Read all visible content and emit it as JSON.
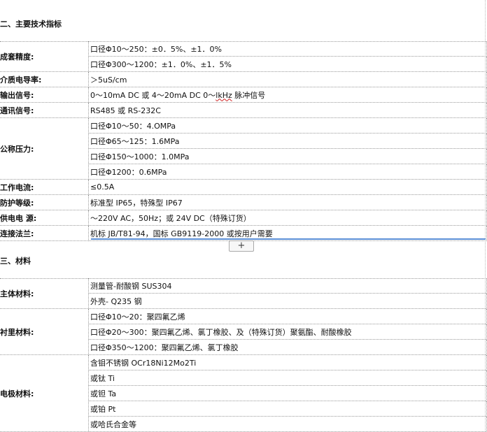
{
  "section2": {
    "title": "二、主要技术指标",
    "rows": [
      {
        "label": "成套精度:",
        "values": [
          "口径Φ10～250：±0．5%、±1．0%",
          "口径Φ300～1200：±1．0%、±1．5%"
        ]
      },
      {
        "label": "介质电导率:",
        "values": [
          "＞5uS/cm"
        ]
      },
      {
        "label": "输出信号:",
        "values": [
          "0～10mA DC 或 4～20mA DC 0～lkHz 脉冲信号"
        ]
      },
      {
        "label": "通讯信号:",
        "values": [
          "RS485 或 RS-232C"
        ]
      },
      {
        "label": "公称压力:",
        "values": [
          "口径Φ10～50：4.OMPa",
          "口径Φ65～125：1.6MPa",
          "口径Φ150～1000：1.0MPa",
          "口径Φ1200：0.6MPa"
        ]
      },
      {
        "label": "工作电流:",
        "values": [
          "≤0.5A"
        ]
      },
      {
        "label": "防护等级:",
        "values": [
          "标准型 IP65，特殊型 IP67"
        ]
      },
      {
        "label": "供电电  源:",
        "values": [
          "～220V AC，50Hz；或 24V DC（特殊订货）"
        ]
      },
      {
        "label": "连接法兰:",
        "values": [
          "机标 JB/T81-94，国标 GB9119-2000 或按用户需要"
        ]
      }
    ]
  },
  "insert_button": {
    "label": "+"
  },
  "section3": {
    "title": "三、材料",
    "rows": [
      {
        "label": "主体材料:",
        "values": [
          "测量管-耐酸钢 SUS304",
          "外壳- Q235 钢"
        ]
      },
      {
        "label": "衬里材料:",
        "values": [
          "口径Φ10～20：聚四氟乙烯",
          "口径Φ20～300：聚四氟乙烯、氯丁橡胶、及（特殊订货）聚氨酯、耐酸橡胶",
          "口径Φ350～1200：聚四氟乙烯、氯丁橡胶"
        ]
      },
      {
        "label": "电极材料:",
        "values": [
          "含钼不锈钢 OCr18Ni12Mo2Ti",
          "或钛 Ti",
          "或钽 Ta",
          "或铂 Pt",
          "或哈氏合金等"
        ]
      }
    ]
  }
}
